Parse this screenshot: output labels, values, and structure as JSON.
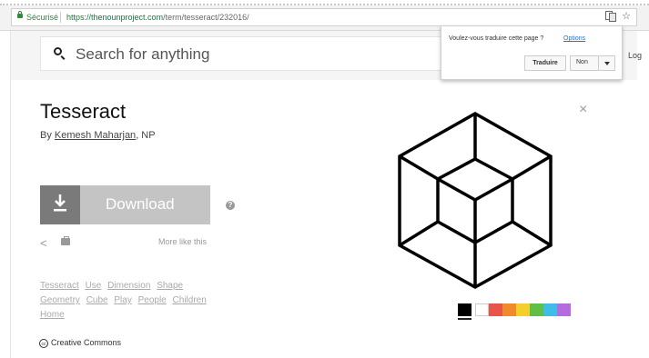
{
  "browser": {
    "secure_label": "Sécurisé",
    "url_host": "https://thenounproject.com",
    "url_path": "/term/tesseract/232016/"
  },
  "translate_popup": {
    "question": "Voulez-vous traduire cette page ?",
    "options_label": "Options",
    "translate_label": "Traduire",
    "decline_label": "Non"
  },
  "header": {
    "search_placeholder": "Search for anything",
    "login_label": "Log"
  },
  "icon": {
    "title": "Tesseract",
    "by_prefix": "By ",
    "author": "Kemesh Maharjan",
    "author_suffix": ", NP",
    "download_label": "Download",
    "help_label": "?",
    "more_like_this": "More like this",
    "tags": [
      "Tesseract",
      "Use",
      "Dimension",
      "Shape",
      "Geometry",
      "Cube",
      "Play",
      "People",
      "Children",
      "Home"
    ],
    "license_icon_text": "cc",
    "license": "Creative Commons",
    "close_label": "×"
  },
  "colors": {
    "swatches": [
      "#000000",
      "#ffffff",
      "#e8534a",
      "#f1892d",
      "#f2cf2b",
      "#61bf45",
      "#3fbde8",
      "#b46be0"
    ],
    "selected_index": 0,
    "download_bg": "#c4c4c4",
    "download_icon_bg": "#7a7a7a"
  }
}
